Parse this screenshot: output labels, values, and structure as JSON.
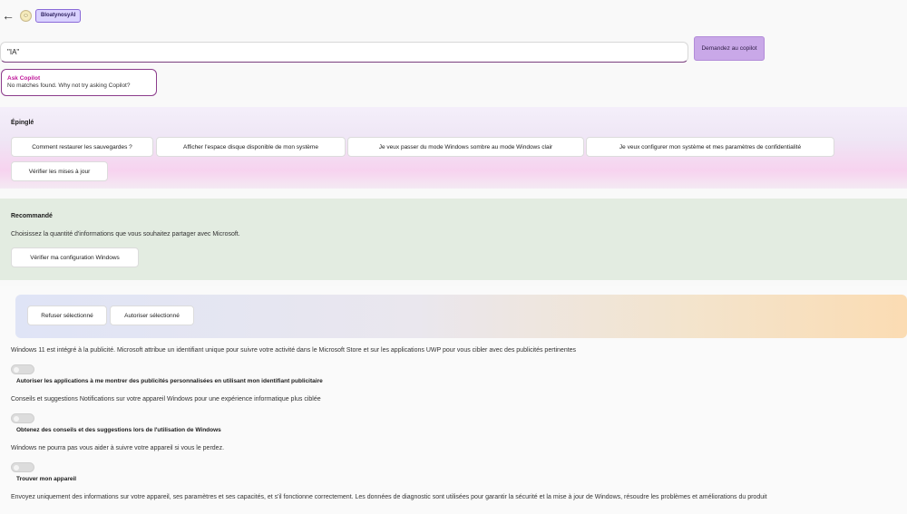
{
  "header": {
    "back_icon": "arrow-left-icon",
    "logo_icon": "smiley-logo-icon",
    "brand": "BloatynosyAI"
  },
  "search": {
    "value": "\"IA\"",
    "ask_button": "Demandez au copilot"
  },
  "ask_copilot": {
    "title": "Ask Copilot",
    "subtitle": "No matches found. Why not try asking Copilot?"
  },
  "pinned": {
    "title": "Épinglé",
    "items": [
      "Comment restaurer les sauvegardes ?",
      "Afficher l'espace disque disponible de mon système",
      "Je veux passer du mode Windows sombre au mode Windows clair",
      "Je veux configurer mon système et mes paramètres de confidentialité",
      "Vérifier les mises à jour"
    ]
  },
  "recommended": {
    "title": "Recommandé",
    "description": "Choisissez la quantité d'informations que vous souhaitez partager avec Microsoft.",
    "button": "Vérifier ma configuration Windows"
  },
  "privacy": {
    "actions": {
      "reject": "Refuser sélectionné",
      "allow": "Autoriser sélectionné"
    },
    "settings": [
      {
        "description": "Windows 11 est intégré à la publicité. Microsoft attribue un identifiant unique pour suivre votre activité dans le Microsoft Store et sur les applications UWP pour vous cibler avec des publicités pertinentes",
        "label": "Autoriser les applications à me montrer des publicités personnalisées en utilisant mon identifiant publicitaire",
        "enabled": false
      },
      {
        "description": "Conseils et suggestions Notifications sur votre appareil Windows pour une expérience informatique plus ciblée",
        "label": "Obtenez des conseils et des suggestions lors de l'utilisation de Windows",
        "enabled": false
      },
      {
        "description": "Windows ne pourra pas vous aider à suivre votre appareil si vous le perdez.",
        "label": "Trouver mon appareil",
        "enabled": false
      },
      {
        "description": "Envoyez uniquement des informations sur votre appareil, ses paramètres et ses capacités, et s'il fonctionne correctement. Les données de diagnostic sont utilisées pour garantir la sécurité et la mise à jour de Windows, résoudre les problèmes et améliorations du produit"
      }
    ]
  }
}
